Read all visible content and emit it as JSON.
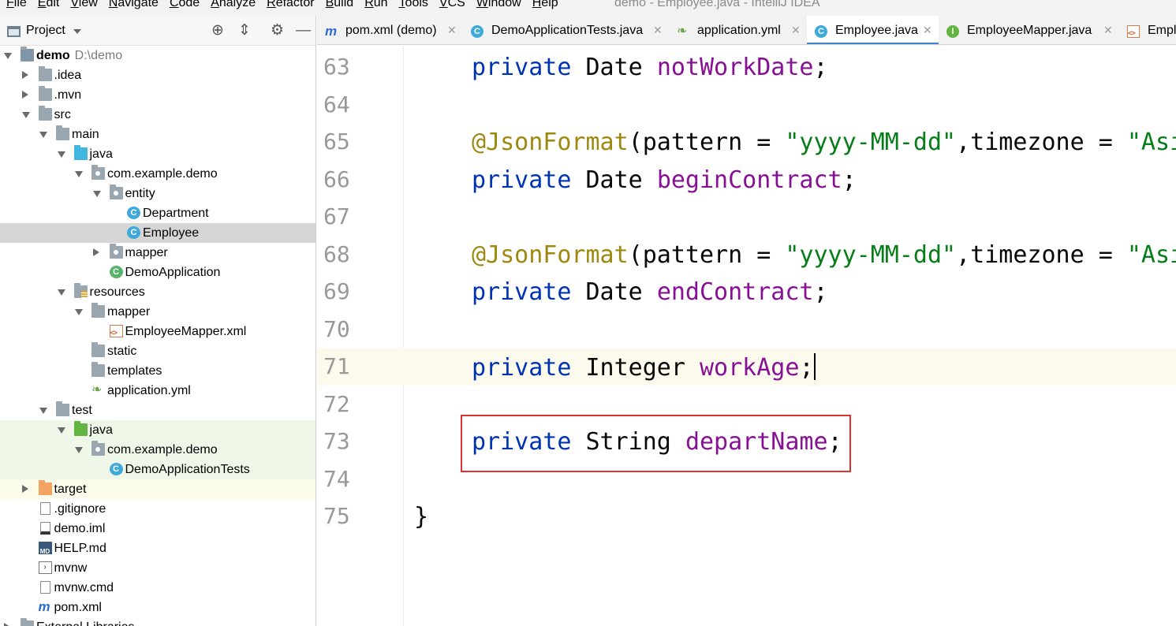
{
  "menu": [
    "File",
    "Edit",
    "View",
    "Navigate",
    "Code",
    "Analyze",
    "Refactor",
    "Build",
    "Run",
    "Tools",
    "VCS",
    "Window",
    "Help"
  ],
  "window_title": "demo - Employee.java - IntelliJ IDEA",
  "project_panel": {
    "title": "Project",
    "tree": [
      {
        "label": "demo",
        "path": "D:\\demo",
        "depth": 0,
        "state": "open",
        "icon": "module-folder-icon"
      },
      {
        "label": ".idea",
        "depth": 1,
        "state": "closed",
        "icon": "folder-icon"
      },
      {
        "label": ".mvn",
        "depth": 1,
        "state": "closed",
        "icon": "folder-icon"
      },
      {
        "label": "src",
        "depth": 1,
        "state": "open",
        "icon": "folder-icon"
      },
      {
        "label": "main",
        "depth": 2,
        "state": "open",
        "icon": "folder-icon"
      },
      {
        "label": "java",
        "depth": 3,
        "state": "open",
        "icon": "source-folder-icon"
      },
      {
        "label": "com.example.demo",
        "depth": 4,
        "state": "open",
        "icon": "package-icon"
      },
      {
        "label": "entity",
        "depth": 5,
        "state": "open",
        "icon": "package-icon"
      },
      {
        "label": "Department",
        "depth": 6,
        "state": "leaf",
        "icon": "class-icon"
      },
      {
        "label": "Employee",
        "depth": 6,
        "state": "leaf",
        "icon": "class-icon",
        "selected": true
      },
      {
        "label": "mapper",
        "depth": 5,
        "state": "closed",
        "icon": "package-icon"
      },
      {
        "label": "DemoApplication",
        "depth": 5,
        "state": "leaf",
        "icon": "spring-boot-class-icon"
      },
      {
        "label": "resources",
        "depth": 3,
        "state": "open",
        "icon": "resources-folder-icon"
      },
      {
        "label": "mapper",
        "depth": 4,
        "state": "open",
        "icon": "folder-icon"
      },
      {
        "label": "EmployeeMapper.xml",
        "depth": 5,
        "state": "leaf",
        "icon": "xml-file-icon"
      },
      {
        "label": "static",
        "depth": 4,
        "state": "leaf",
        "icon": "folder-icon"
      },
      {
        "label": "templates",
        "depth": 4,
        "state": "leaf",
        "icon": "folder-icon"
      },
      {
        "label": "application.yml",
        "depth": 4,
        "state": "leaf",
        "icon": "yaml-file-icon"
      },
      {
        "label": "test",
        "depth": 2,
        "state": "open",
        "icon": "folder-icon"
      },
      {
        "label": "java",
        "depth": 3,
        "state": "open",
        "icon": "test-source-folder-icon",
        "test": true
      },
      {
        "label": "com.example.demo",
        "depth": 4,
        "state": "open",
        "icon": "package-icon",
        "test": true
      },
      {
        "label": "DemoApplicationTests",
        "depth": 5,
        "state": "leaf",
        "icon": "class-icon",
        "test": true
      },
      {
        "label": "target",
        "depth": 1,
        "state": "closed",
        "icon": "excluded-folder-icon",
        "excluded": true
      },
      {
        "label": ".gitignore",
        "depth": 1,
        "state": "leaf",
        "icon": "text-file-icon"
      },
      {
        "label": "demo.iml",
        "depth": 1,
        "state": "leaf",
        "icon": "iml-file-icon"
      },
      {
        "label": "HELP.md",
        "depth": 1,
        "state": "leaf",
        "icon": "markdown-file-icon"
      },
      {
        "label": "mvnw",
        "depth": 1,
        "state": "leaf",
        "icon": "shell-script-icon"
      },
      {
        "label": "mvnw.cmd",
        "depth": 1,
        "state": "leaf",
        "icon": "text-file-icon"
      },
      {
        "label": "pom.xml",
        "depth": 1,
        "state": "leaf",
        "icon": "maven-icon"
      },
      {
        "label": "External Libraries",
        "depth": 0,
        "state": "closed",
        "icon": "library-icon"
      }
    ]
  },
  "tabs": [
    {
      "label": "pom.xml (demo)",
      "icon": "maven-icon",
      "active": false
    },
    {
      "label": "DemoApplicationTests.java",
      "icon": "class-icon",
      "active": false
    },
    {
      "label": "application.yml",
      "icon": "yaml-file-icon",
      "active": false
    },
    {
      "label": "Employee.java",
      "icon": "class-icon",
      "active": true
    },
    {
      "label": "EmployeeMapper.java",
      "icon": "interface-icon",
      "active": false
    },
    {
      "label": "Emplo",
      "icon": "xml-file-icon",
      "active": false
    }
  ],
  "editor": {
    "lines": [
      {
        "no": "63",
        "tokens": [
          [
            "kw",
            "private"
          ],
          [
            "pl",
            " Date "
          ],
          [
            "fld",
            "notWorkDate"
          ],
          [
            "pl",
            ";"
          ]
        ]
      },
      {
        "no": "64",
        "tokens": []
      },
      {
        "no": "65",
        "tokens": [
          [
            "ann",
            "@JsonFormat"
          ],
          [
            "pl",
            "(pattern = "
          ],
          [
            "str",
            "\"yyyy-MM-dd\""
          ],
          [
            "pl",
            ",timezone = "
          ],
          [
            "str",
            "\"Asi"
          ]
        ]
      },
      {
        "no": "66",
        "tokens": [
          [
            "kw",
            "private"
          ],
          [
            "pl",
            " Date "
          ],
          [
            "fld",
            "beginContract"
          ],
          [
            "pl",
            ";"
          ]
        ]
      },
      {
        "no": "67",
        "tokens": []
      },
      {
        "no": "68",
        "tokens": [
          [
            "ann",
            "@JsonFormat"
          ],
          [
            "pl",
            "(pattern = "
          ],
          [
            "str",
            "\"yyyy-MM-dd\""
          ],
          [
            "pl",
            ",timezone = "
          ],
          [
            "str",
            "\"Asi"
          ]
        ]
      },
      {
        "no": "69",
        "tokens": [
          [
            "kw",
            "private"
          ],
          [
            "pl",
            " Date "
          ],
          [
            "fld",
            "endContract"
          ],
          [
            "pl",
            ";"
          ]
        ]
      },
      {
        "no": "70",
        "tokens": []
      },
      {
        "no": "71",
        "tokens": [
          [
            "kw",
            "private"
          ],
          [
            "pl",
            " Integer "
          ],
          [
            "fld",
            "workAge"
          ],
          [
            "pl",
            ";"
          ]
        ],
        "current": true
      },
      {
        "no": "72",
        "tokens": []
      },
      {
        "no": "73",
        "tokens": [
          [
            "kw",
            "private"
          ],
          [
            "pl",
            " String "
          ],
          [
            "fld",
            "departName"
          ],
          [
            "pl",
            ";"
          ]
        ],
        "highlighted": true
      },
      {
        "no": "74",
        "tokens": []
      },
      {
        "no": "75",
        "tokens": [
          [
            "pl",
            "}"
          ]
        ],
        "brace": true
      }
    ]
  },
  "colors": {
    "keyword": "#0033b3",
    "field": "#871094",
    "annotation": "#9e880d",
    "string": "#067d17",
    "highlight_box": "#e03030",
    "active_tab_underline": "#4083c9"
  }
}
